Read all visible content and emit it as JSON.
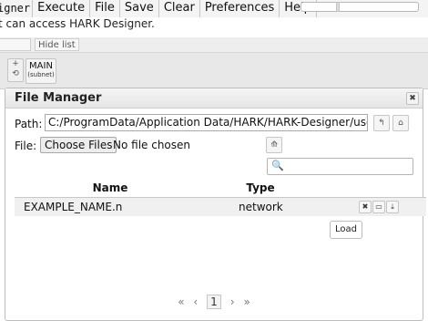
{
  "menubar": {
    "app_title": "igner",
    "items": [
      "Execute",
      "File",
      "Save",
      "Clear",
      "Preferences",
      "Help"
    ]
  },
  "info_text": "t can access HARK Designer.",
  "subbar": {
    "hide_list": "Hide list"
  },
  "tab": {
    "title": "MAIN",
    "subtitle": "(subnet)",
    "controls": "+",
    "controls2": "⟲"
  },
  "dialog": {
    "title": "File Manager",
    "close_icon": "close-icon",
    "path_label": "Path:",
    "path_value": "C:/ProgramData/Application Data/HARK/HARK-Designer/userdata/networks",
    "file_label": "File:",
    "choose_label": "Choose Files",
    "no_file_text": "No file chosen",
    "search_placeholder": "",
    "columns": [
      "Name",
      "Type"
    ],
    "rows": [
      {
        "name": "EXAMPLE_NAME.n",
        "type": "network"
      }
    ],
    "tooltip": "Load",
    "pager": {
      "first": "«",
      "prev": "‹",
      "page": "1",
      "next": "›",
      "last": "»"
    }
  }
}
